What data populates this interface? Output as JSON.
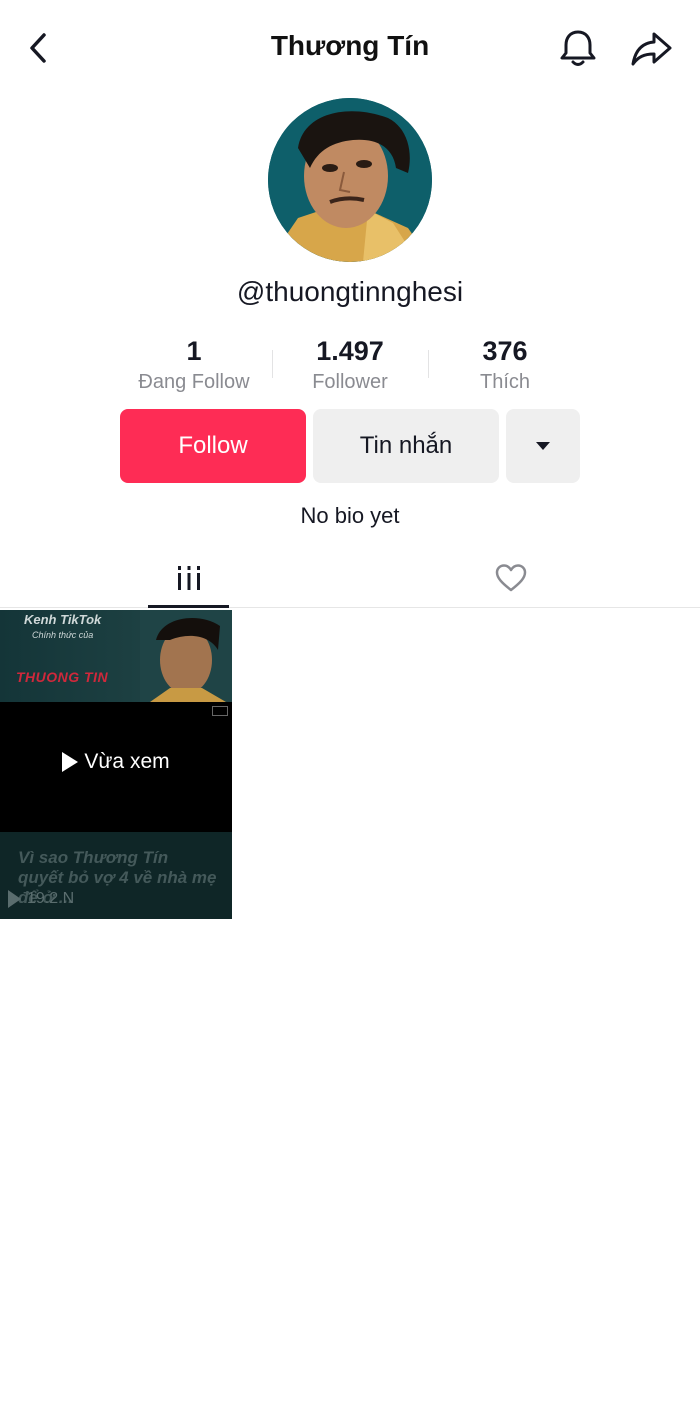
{
  "header": {
    "title": "Thương Tín"
  },
  "profile": {
    "username": "@thuongtinnghesi",
    "bio": "No bio yet"
  },
  "stats": [
    {
      "value": "1",
      "label": "Đang Follow"
    },
    {
      "value": "1.497",
      "label": "Follower"
    },
    {
      "value": "376",
      "label": "Thích"
    }
  ],
  "actions": {
    "follow_label": "Follow",
    "message_label": "Tin nhắn"
  },
  "videos": [
    {
      "thumb_line1": "Kenh TikTok",
      "thumb_line2": "Chính thức của",
      "thumb_line3": "THUONG TIN",
      "watched_label": "Vừa xem",
      "caption": "Vì sao Thương Tín quyết bỏ vợ 4 về nhà mẹ để ở ...",
      "views": "19.2 N"
    }
  ],
  "colors": {
    "follow_bg": "#fe2c55",
    "secondary_btn_bg": "#efefef",
    "muted_text": "#8a8b91"
  },
  "icons": {
    "back": "chevron-left-icon",
    "bell": "bell-icon",
    "share": "share-arrow-icon",
    "videos_tab": "grid-bars-icon",
    "liked_tab": "heart-outline-icon",
    "more": "caret-down-icon"
  }
}
